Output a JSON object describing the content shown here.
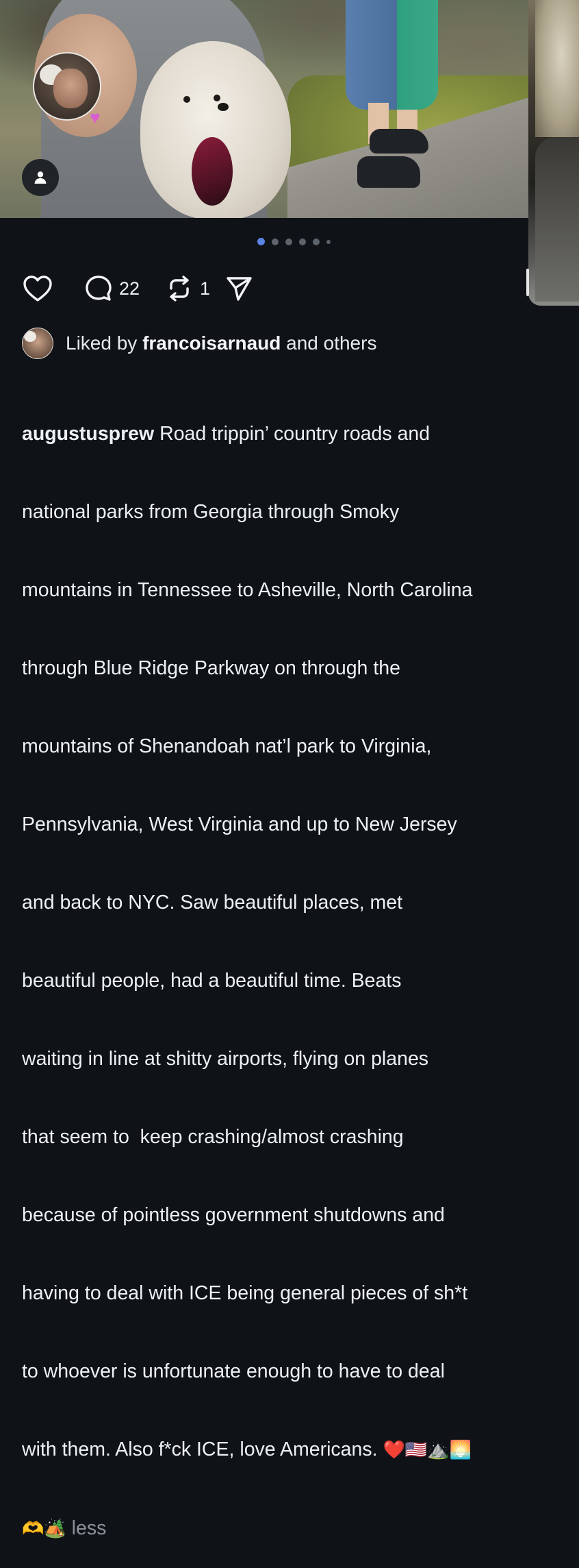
{
  "post": {
    "actions": {
      "comments_count": "22",
      "reposts_count": "1"
    },
    "carousel": {
      "total_dots": 6,
      "active_index": 0
    },
    "liked_by": {
      "prefix": "Liked by ",
      "username": "francoisarnaud",
      "suffix": " and others"
    },
    "caption": {
      "username": "augustusprew",
      "lines": [
        " Road trippin’ country roads and",
        "national parks from Georgia through Smoky",
        "mountains in Tennessee to Asheville, North Carolina",
        "through Blue Ridge Parkway on through the",
        "mountains of Shenandoah nat’l park to Virginia,",
        "Pennsylvania, West Virginia and up to New Jersey",
        "and back to NYC. Saw beautiful places, met",
        "beautiful people, had a beautiful time. Beats",
        "waiting in line at shitty airports, flying on planes",
        "that seem to  keep crashing/almost crashing",
        "because of pointless government shutdowns and",
        "having to deal with ICE being general pieces of sh*t",
        "to whoever is unfortunate enough to have to deal",
        "with them. Also f*ck ICE, love Americans. "
      ],
      "emojis_line1": "❤️🇺🇸⛰️🌅",
      "emojis_line2": "🫶🏕️",
      "less_label": "less"
    }
  },
  "colors": {
    "background": "#0f1317",
    "active_dot": "#5a83e6",
    "muted_text": "#8b929b"
  }
}
